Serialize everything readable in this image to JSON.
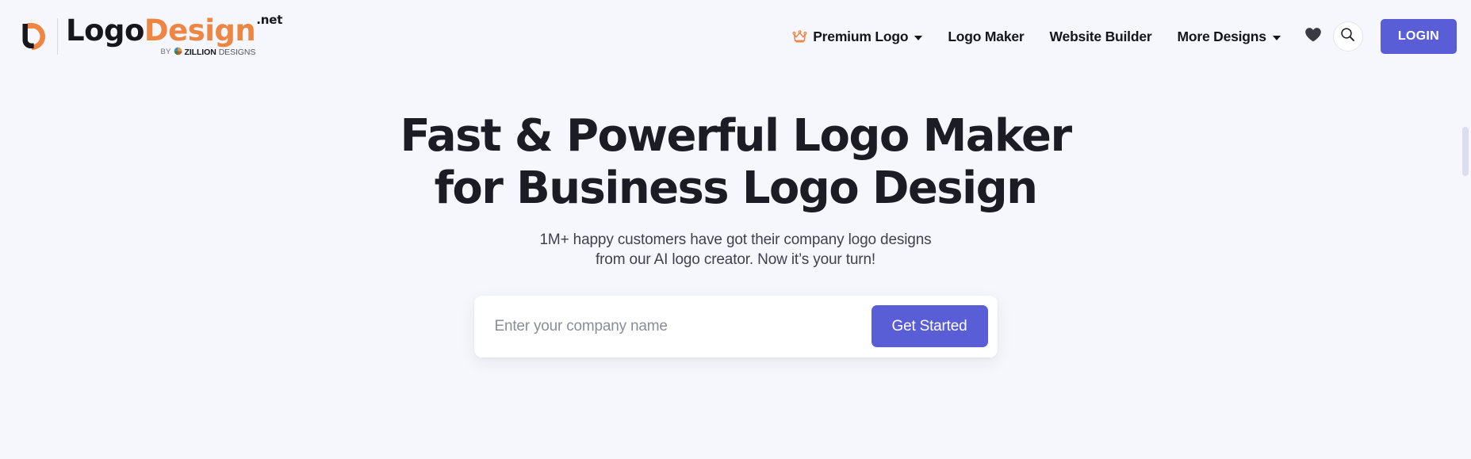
{
  "brand": {
    "name_part1": "Logo",
    "name_part2": "Design",
    "tld": ".net",
    "by_label": "BY",
    "parent_strong": "ZILLION",
    "parent_light": "DESIGNS",
    "mark_icon": "logodesign-ld-monogram-icon",
    "colors": {
      "black": "#16161c",
      "orange": "#ef8543"
    }
  },
  "nav": {
    "items": [
      {
        "label": "Premium Logo",
        "has_caret": true,
        "icon": "crown-icon"
      },
      {
        "label": "Logo Maker",
        "has_caret": false,
        "icon": null
      },
      {
        "label": "Website Builder",
        "has_caret": false,
        "icon": null
      },
      {
        "label": "More Designs",
        "has_caret": true,
        "icon": null
      }
    ],
    "favorites_icon": "heart-icon",
    "search_icon": "search-icon",
    "login_label": "LOGIN",
    "login_color": "#5a5ed6"
  },
  "hero": {
    "title_line1": "Fast & Powerful Logo Maker",
    "title_line2": "for Business Logo Design",
    "sub_line1": "1M+ happy customers have got their company logo designs",
    "sub_line2": "from our AI logo creator. Now it’s your turn!"
  },
  "cta": {
    "input_value": "",
    "input_placeholder": "Enter your company name",
    "button_label": "Get Started",
    "button_color": "#5a5ed6"
  },
  "page": {
    "background": "#f5f7fc"
  }
}
